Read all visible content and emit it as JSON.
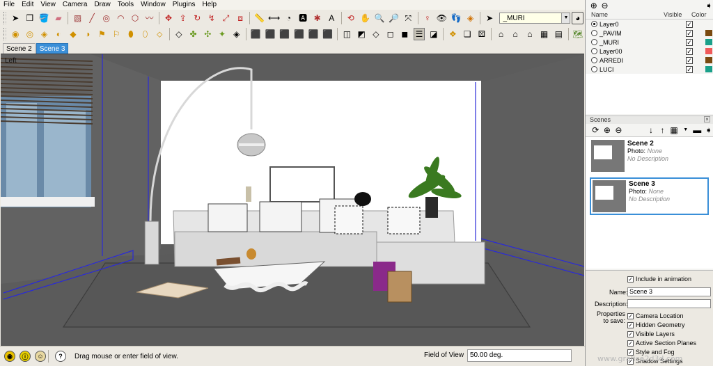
{
  "menu": [
    "File",
    "Edit",
    "View",
    "Camera",
    "Draw",
    "Tools",
    "Window",
    "Plugins",
    "Help"
  ],
  "toolbar": {
    "layer_value": "_MURI"
  },
  "scene_tabs": [
    {
      "label": "Scene 2",
      "active": false
    },
    {
      "label": "Scene 3",
      "active": true
    }
  ],
  "viewport": {
    "view_label": "Left"
  },
  "status": {
    "message": "Drag mouse or enter field of view.",
    "vcb_label": "Field of View",
    "vcb_value": "50.00 deg."
  },
  "layers": {
    "col_name": "Name",
    "col_visible": "Visible",
    "col_color": "Color",
    "rows": [
      {
        "name": "Layer0",
        "active": true,
        "visible": true,
        "color": ""
      },
      {
        "name": "_PAVIM",
        "active": false,
        "visible": true,
        "color": "#7a4a10"
      },
      {
        "name": "_MURI",
        "active": false,
        "visible": true,
        "color": "#1aa08a"
      },
      {
        "name": "Layer00",
        "active": false,
        "visible": true,
        "color": "#f05a5a"
      },
      {
        "name": "ARREDI",
        "active": false,
        "visible": true,
        "color": "#7a4a10"
      },
      {
        "name": "LUCI",
        "active": false,
        "visible": true,
        "color": "#1aa08a"
      }
    ]
  },
  "scenes": {
    "title": "Scenes",
    "list": [
      {
        "name": "Scene 2",
        "photo_label": "Photo:",
        "photo": "None",
        "description": "No Description",
        "selected": false
      },
      {
        "name": "Scene 3",
        "photo_label": "Photo:",
        "photo": "None",
        "description": "No Description",
        "selected": true
      }
    ],
    "props": {
      "include_label": "Include in animation",
      "name_label": "Name:",
      "name_value": "Scene 3",
      "description_label": "Description:",
      "description_value": "",
      "properties_label": "Properties",
      "to_save_label": "to save:",
      "checks": [
        "Camera Location",
        "Hidden Geometry",
        "Visible Layers",
        "Active Section Planes",
        "Style and Fog",
        "Shadow Settings"
      ]
    }
  },
  "watermark": "www.grafica2d3d.com"
}
